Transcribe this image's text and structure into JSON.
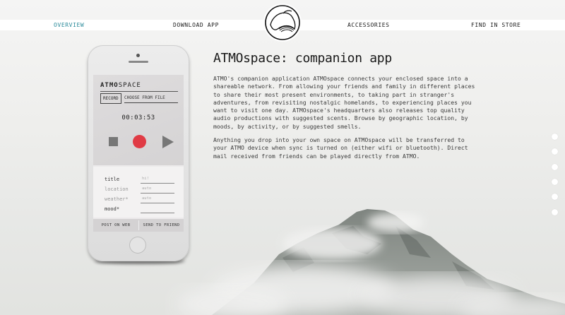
{
  "nav": {
    "items": [
      {
        "label": "OVERVIEW",
        "active": true
      },
      {
        "label": "DOWNLOAD APP",
        "active": false
      },
      {
        "label": "ACCESSORIES",
        "active": false
      },
      {
        "label": "FIND IN STORE",
        "active": false
      }
    ],
    "active_color": "#2a8a9a",
    "logo_icon": "atmo-logo-icon"
  },
  "phone": {
    "app_title_bold": "ATMO",
    "app_title_rest": "SPACE",
    "record_label": "RECORD",
    "choose_label": "CHOOSE FROM FILE",
    "timer": "00:03:53",
    "controls": [
      "stop-icon",
      "record-icon",
      "play-icon"
    ],
    "record_color": "#e03b45",
    "form": {
      "title_label": "title",
      "title_placeholder": "hi!",
      "location_label": "location",
      "location_placeholder": "auto",
      "weather_label": "weather*",
      "weather_placeholder": "auto",
      "mood_label": "mood*",
      "mood_placeholder": ""
    },
    "post_label": "POST ON WEB",
    "send_label": "SEND TO FRIEND"
  },
  "content": {
    "heading": "ATMOspace: companion app",
    "paragraph1": "ATMO's companion application ATMOspace connects your enclosed space into a shareable network. From allowing your friends and family in different places to share their most present environments, to taking part in stranger's adventures, from revisiting nostalgic homelands, to experiencing places you want to visit one day. ATMOspace's headquarters also releases top quality audio productions with suggested scents. Browse by geographic location, by moods, by activity, or by suggested smells.",
    "paragraph2": "Anything you drop into your own space on ATMOspace will be transferred to your ATMO device when sync is turned on (either wifi or bluetooth). Direct mail received from friends can be played directly from ATMO."
  },
  "side_nav": {
    "dot_count": 6,
    "dot_color": "#ffffff"
  }
}
